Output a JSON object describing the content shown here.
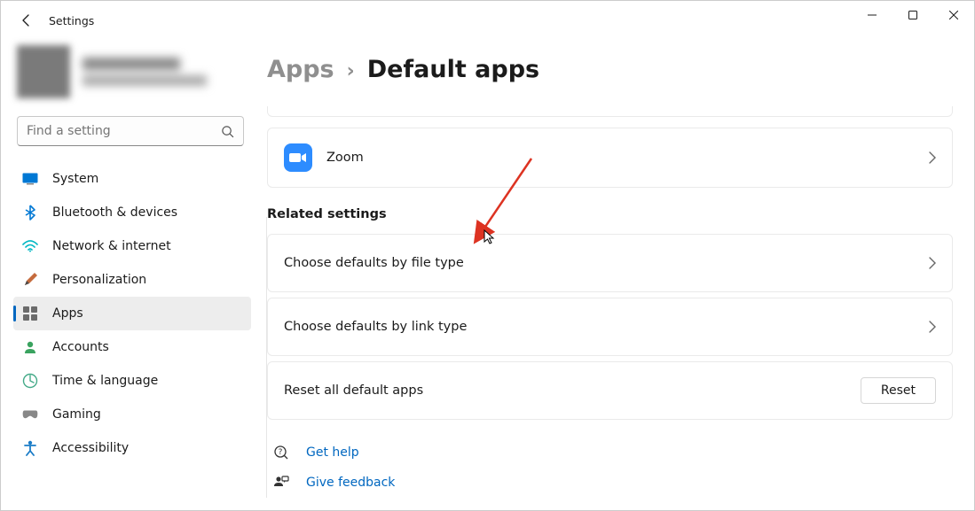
{
  "window": {
    "title": "Settings"
  },
  "search": {
    "placeholder": "Find a setting"
  },
  "nav": {
    "items": [
      {
        "label": "System"
      },
      {
        "label": "Bluetooth & devices"
      },
      {
        "label": "Network & internet"
      },
      {
        "label": "Personalization"
      },
      {
        "label": "Apps"
      },
      {
        "label": "Accounts"
      },
      {
        "label": "Time & language"
      },
      {
        "label": "Gaming"
      },
      {
        "label": "Accessibility"
      }
    ]
  },
  "breadcrumb": {
    "parent": "Apps",
    "current": "Default apps"
  },
  "main": {
    "app_row": {
      "label": "Zoom"
    },
    "related_title": "Related settings",
    "rows": [
      {
        "label": "Choose defaults by file type"
      },
      {
        "label": "Choose defaults by link type"
      },
      {
        "label": "Reset all default apps",
        "button": "Reset"
      }
    ],
    "help": [
      {
        "label": "Get help"
      },
      {
        "label": "Give feedback"
      }
    ]
  }
}
